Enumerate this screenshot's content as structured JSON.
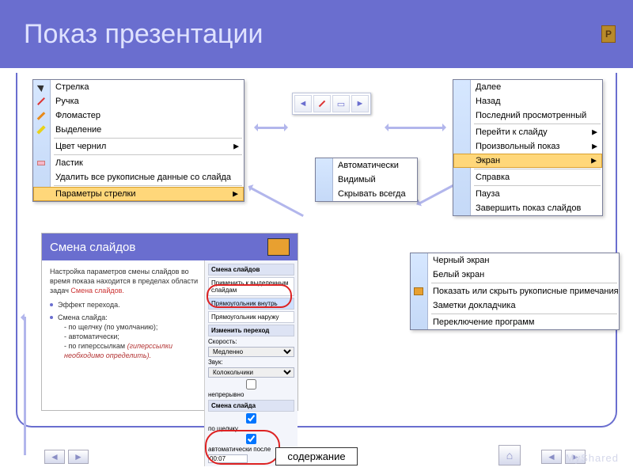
{
  "title": "Показ презентации",
  "corner_badge": "P",
  "pointer_menu": {
    "items": [
      {
        "label": "Стрелка",
        "icon": "cursor"
      },
      {
        "label": "Ручка",
        "icon": "pen"
      },
      {
        "label": "Фломастер",
        "icon": "pen2"
      },
      {
        "label": "Выделение",
        "icon": "hl"
      }
    ],
    "ink_color": "Цвет чернил",
    "eraser": "Ластик",
    "erase_all": "Удалить все рукописные данные со слайда",
    "arrow_options": "Параметры стрелки"
  },
  "arrow_submenu": [
    "Автоматически",
    "Видимый",
    "Скрывать всегда"
  ],
  "right_menu": {
    "items_top": [
      "Далее",
      "Назад",
      "Последний просмотренный"
    ],
    "goto": "Перейти к слайду",
    "custom": "Произвольный показ",
    "screen": "Экран",
    "help": "Справка",
    "pause": "Пауза",
    "end": "Завершить показ слайдов"
  },
  "screen_submenu": [
    "Черный экран",
    "Белый экран",
    "Показать или скрыть рукописные примечания",
    "Заметки докладчика",
    "Переключение программ"
  ],
  "panel": {
    "title": "Смена слайдов",
    "para1a": "Настройка параметров смены слайдов во время показа находится в пределах области задач ",
    "para1b": "Смена слайдов.",
    "bullet1": "Эффект перехода.",
    "bullet2": "Смена слайда:",
    "sub1": "- по щелчку (по умолчанию);",
    "sub2": "- автоматически;",
    "sub3a": "- по гиперссылкам ",
    "sub3b": "(гиперссылки необходимо определить).",
    "right": {
      "title": "Смена слайдов",
      "apply": "Применить к выделенным слайдам",
      "opt_in": "Прямоугольник внутрь",
      "opt_out": "Прямоугольник наружу",
      "change": "Изменить переход",
      "speed_lbl": "Скорость:",
      "speed": "Медленно",
      "sound_lbl": "Звук:",
      "sound": "Колокольчики",
      "loop": "непрерывно",
      "advance": "Смена слайда",
      "click": "по щелчку",
      "auto": "автоматически после",
      "time": "00:07"
    }
  },
  "footer_label": "содержание",
  "watermark": "MyShared"
}
